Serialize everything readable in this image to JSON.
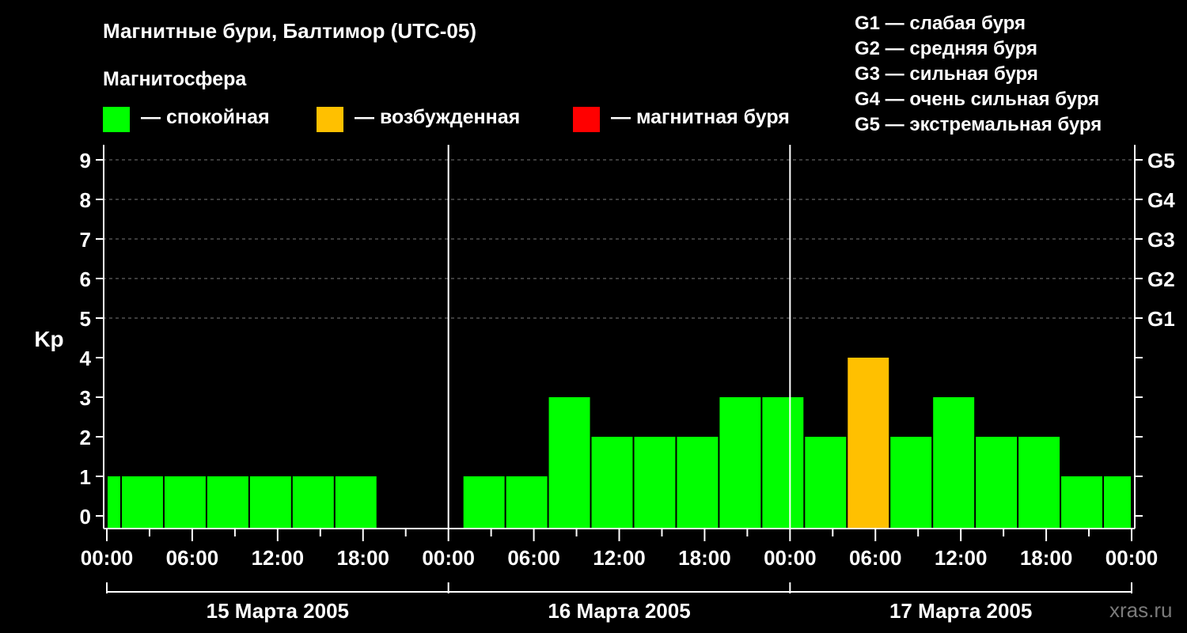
{
  "title": "Магнитные бури, Балтимор (UTC-05)",
  "legend": {
    "title": "Магнитосфера",
    "items": [
      {
        "label": "— спокойная",
        "color": "#00ff00"
      },
      {
        "label": "— возбужденная",
        "color": "#ffc000"
      },
      {
        "label": "— магнитная буря",
        "color": "#ff0000"
      }
    ]
  },
  "g_scale": [
    "G1 — слабая буря",
    "G2 — средняя буря",
    "G3 — сильная буря",
    "G4 — очень сильная буря",
    "G5 — экстремальная буря"
  ],
  "watermark": "xras.ru",
  "chart_data": {
    "type": "bar",
    "ylabel": "Kp",
    "ylim": [
      0,
      9
    ],
    "yticks": [
      0,
      1,
      2,
      3,
      4,
      5,
      6,
      7,
      8,
      9
    ],
    "right_ticks": [
      {
        "value": 5,
        "label": "G1"
      },
      {
        "value": 6,
        "label": "G2"
      },
      {
        "value": 7,
        "label": "G3"
      },
      {
        "value": 8,
        "label": "G4"
      },
      {
        "value": 9,
        "label": "G5"
      }
    ],
    "grid": "dashed horizontal at 5-9",
    "x_range_hours": [
      0,
      72
    ],
    "xtick_labels": [
      "00:00",
      "06:00",
      "12:00",
      "18:00",
      "00:00",
      "06:00",
      "12:00",
      "18:00",
      "00:00",
      "06:00",
      "12:00",
      "18:00",
      "00:00"
    ],
    "days": [
      "15 Марта 2005",
      "16 Марта 2005",
      "17 Марта 2005"
    ],
    "colors": {
      "quiet": "#00ff00",
      "active": "#ffc000",
      "storm": "#ff0000"
    },
    "bars": [
      {
        "start": 0,
        "end": 1,
        "kp": 1,
        "level": "quiet"
      },
      {
        "start": 1,
        "end": 4,
        "kp": 1,
        "level": "quiet"
      },
      {
        "start": 4,
        "end": 7,
        "kp": 1,
        "level": "quiet"
      },
      {
        "start": 7,
        "end": 10,
        "kp": 1,
        "level": "quiet"
      },
      {
        "start": 10,
        "end": 13,
        "kp": 1,
        "level": "quiet"
      },
      {
        "start": 13,
        "end": 16,
        "kp": 1,
        "level": "quiet"
      },
      {
        "start": 16,
        "end": 19,
        "kp": 1,
        "level": "quiet"
      },
      {
        "start": 25,
        "end": 28,
        "kp": 1,
        "level": "quiet"
      },
      {
        "start": 28,
        "end": 31,
        "kp": 1,
        "level": "quiet"
      },
      {
        "start": 31,
        "end": 34,
        "kp": 3,
        "level": "quiet"
      },
      {
        "start": 34,
        "end": 37,
        "kp": 2,
        "level": "quiet"
      },
      {
        "start": 37,
        "end": 40,
        "kp": 2,
        "level": "quiet"
      },
      {
        "start": 40,
        "end": 43,
        "kp": 2,
        "level": "quiet"
      },
      {
        "start": 43,
        "end": 46,
        "kp": 3,
        "level": "quiet"
      },
      {
        "start": 46,
        "end": 49,
        "kp": 3,
        "level": "quiet"
      },
      {
        "start": 49,
        "end": 52,
        "kp": 2,
        "level": "quiet"
      },
      {
        "start": 52,
        "end": 55,
        "kp": 4,
        "level": "active"
      },
      {
        "start": 55,
        "end": 58,
        "kp": 2,
        "level": "quiet"
      },
      {
        "start": 58,
        "end": 61,
        "kp": 3,
        "level": "quiet"
      },
      {
        "start": 61,
        "end": 64,
        "kp": 2,
        "level": "quiet"
      },
      {
        "start": 64,
        "end": 67,
        "kp": 2,
        "level": "quiet"
      },
      {
        "start": 67,
        "end": 70,
        "kp": 1,
        "level": "quiet"
      },
      {
        "start": 70,
        "end": 72,
        "kp": 1,
        "level": "quiet"
      }
    ]
  }
}
